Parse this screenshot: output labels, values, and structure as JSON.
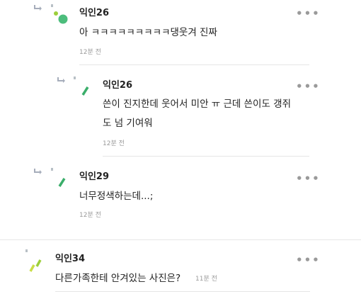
{
  "colors": {
    "avatar_green": "#4cbd7c",
    "avatar_lime": "#9ccf3b",
    "avatar_yellow": "#c9dd48",
    "reply_arrow": "#a6adbb",
    "muted_text": "#9a9a9a",
    "divider": "#e6e6e6"
  },
  "icons": {
    "reply": "reply-arrow-icon",
    "more": "more-dots-icon"
  },
  "comments": [
    {
      "nick": "익인26",
      "body_lines": [
        "아 ㅋㅋㅋㅋㅋㅋㅋㅋㅋ댕웃겨 진짜"
      ],
      "time": "12분 전",
      "more_label": "•••"
    },
    {
      "nick": "익인26",
      "body_lines": [
        "쓴이 진지한데 웃어서 미안 ㅠ 근데 쓴이도 갱쥐",
        "도 넘 기여워"
      ],
      "time": "12분 전",
      "more_label": "•••"
    },
    {
      "nick": "익인29",
      "body_lines": [
        "너무정색하는데...;"
      ],
      "time": "12분 전",
      "more_label": "•••"
    },
    {
      "nick": "익인34",
      "body_lines": [
        "다른가족한테 안겨있는 사진은?"
      ],
      "time": "11분 전",
      "more_label": "•••"
    }
  ]
}
